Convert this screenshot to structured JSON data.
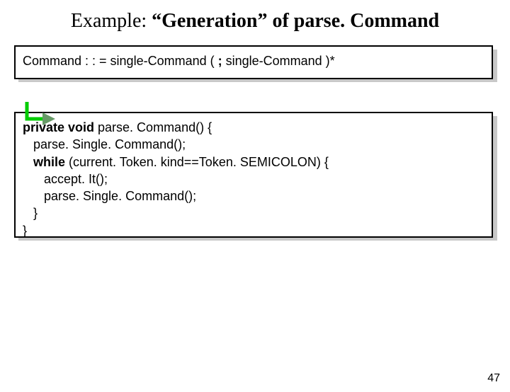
{
  "title": {
    "prefix": "Example: ",
    "quoted": "“Generation”",
    "suffix": " of parse. Command"
  },
  "grammar": {
    "lhs": "Command : : = single-Command ( ",
    "semi": ";",
    "rhs": " single-Command )*"
  },
  "code": {
    "l1a": "private void",
    "l1b": " parse. Command() {",
    "l2": "   parse. Single. Command();",
    "l3a": "   ",
    "l3b": "while",
    "l3c": " (current. Token. kind==Token. SEMICOLON) {",
    "l4": "      accept. It();",
    "l5": "      parse. Single. Command();",
    "l6": "   }",
    "l7": "}"
  },
  "arrow": {
    "stroke": "#00cc00",
    "fill": "#669966"
  },
  "page_number": "47"
}
